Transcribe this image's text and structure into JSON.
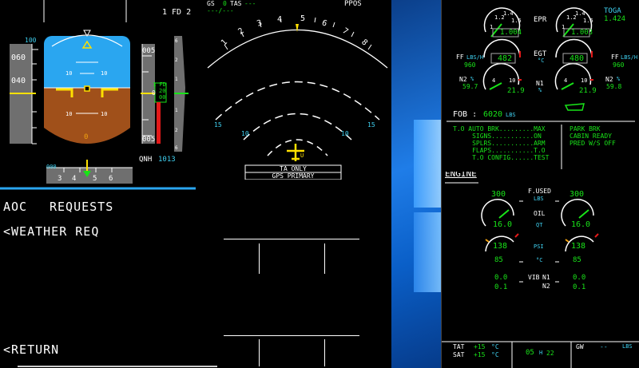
{
  "pfd": {
    "fd_label": "1 FD 2",
    "speed_target": "100",
    "speed_ticks": [
      "060",
      "040"
    ],
    "pitch_labels_upper": [
      "10",
      "10"
    ],
    "pitch_labels_lower": [
      "10",
      "10"
    ],
    "pitch_zero": "0",
    "alt_labels": [
      "005",
      "005"
    ],
    "alt_window": [
      "20",
      "00",
      "0",
      "0"
    ],
    "alt_box_top": "1 FD",
    "alt_tick": "0",
    "qnh_label": "QNH",
    "qnh_value": "1013",
    "heading_ticks": [
      "3",
      "4",
      "5",
      "6"
    ],
    "heading_target": "000",
    "vsi_marks": [
      "6",
      "2",
      "1",
      "1",
      "2",
      "6"
    ]
  },
  "nd": {
    "gs_label": "GS",
    "gs_value": "0",
    "tas_label": "TAS",
    "tas_value": "---",
    "wind_value": "---/---",
    "mode_label": "PPOS",
    "compass_labels": [
      "1",
      "2",
      "3",
      "4",
      "5",
      "6",
      "7",
      "8"
    ],
    "range_labels": [
      "15",
      "10",
      "10",
      "15"
    ],
    "ta_only": "TA ONLY",
    "gps_primary": "GPS PRIMARY",
    "vor_mark": "U"
  },
  "mcdu": {
    "title_left": "AOC",
    "title_right": "REQUESTS",
    "line1": "<WEATHER REQ",
    "line6": "<RETURN"
  },
  "ewd": {
    "epr_label": "EPR",
    "epr_values": [
      "1.004",
      "1.003"
    ],
    "epr_ticks": [
      "1.2",
      "1.4",
      "1.6",
      "1"
    ],
    "toga_label": "TOGA",
    "toga_value": "1.424",
    "egt_label": "EGT",
    "egt_unit": "°C",
    "egt_values": [
      "482",
      "480"
    ],
    "ff_label": "FF",
    "ff_unit": "LBS/H",
    "ff_values": [
      "960",
      "960"
    ],
    "n2_label": "N2",
    "n2_unit": "%",
    "n2_values": [
      "59.7",
      "59.8"
    ],
    "n1_label": "N1",
    "n1_unit": "%",
    "n1_values": [
      "21.9",
      "21.9"
    ],
    "n1_ticks": [
      "4",
      "10"
    ],
    "fob_label": "FOB :",
    "fob_value": "6020",
    "fob_unit": "LBS",
    "memo_left": [
      "T.O AUTO BRK.........MAX",
      "     SIGNS...........ON",
      "     SPLRS...........ARM",
      "     FLAPS...........T.O",
      "     T.O CONFIG......TEST"
    ],
    "memo_right": [
      "PARK BRK",
      "CABIN READY",
      "PRED W/S OFF"
    ]
  },
  "sd": {
    "page_title": "ENGINE",
    "fused_label": "F.USED",
    "fused_unit": "LBS",
    "fused_values": [
      "300",
      "300"
    ],
    "oil_label": "OIL",
    "qt_unit": "QT",
    "oil_qt_values": [
      "16.0",
      "16.0"
    ],
    "psi_unit": "PSI",
    "oil_psi_values": [
      "138",
      "138"
    ],
    "temp_unit": "°C",
    "temp_values": [
      "85",
      "85"
    ],
    "vib_label": "VIB",
    "vib_n1_label": "N1",
    "vib_n2_label": "N2",
    "vib_n1_values": [
      "0.0",
      "0.0"
    ],
    "vib_n2_values": [
      "0.1",
      "0.1"
    ],
    "tat_label": "TAT",
    "tat_value": "+15",
    "sat_label": "SAT",
    "sat_value": "+15",
    "temp_small_unit": "°C",
    "time_hours": "05",
    "time_h": "H",
    "time_minutes": "22",
    "gw_label": "GW",
    "gw_value": "--",
    "gw_unit": "LBS"
  },
  "colors": {
    "cyan": "#3fd0f0",
    "green": "#19e319",
    "amber": "#f0a010",
    "sky": "#2aa6f0",
    "ground": "#a0501a",
    "desktop_blue": "#0a6fd6"
  }
}
